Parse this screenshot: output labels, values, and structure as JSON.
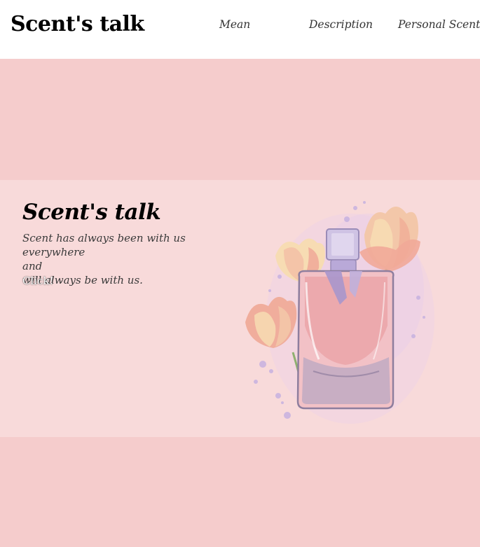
{
  "header": {
    "logo": "Scent's talk",
    "nav": {
      "mean": "Mean",
      "description": "Description",
      "personal_scent": "Personal Scent"
    }
  },
  "hero": {
    "title": "Scent's talk",
    "lines": [
      "Scent has always been with us everywhere",
      "and",
      "will always be with us."
    ],
    "cta": "Click!",
    "illustration": "perfume-bottle-with-tulips"
  },
  "colors": {
    "header_bg": "#ffffff",
    "band_pink": "#f5cccc",
    "hero_pink": "#f8dada",
    "title": "#000000",
    "text": "#3a3a3a",
    "cta_text": "#ffffff"
  }
}
